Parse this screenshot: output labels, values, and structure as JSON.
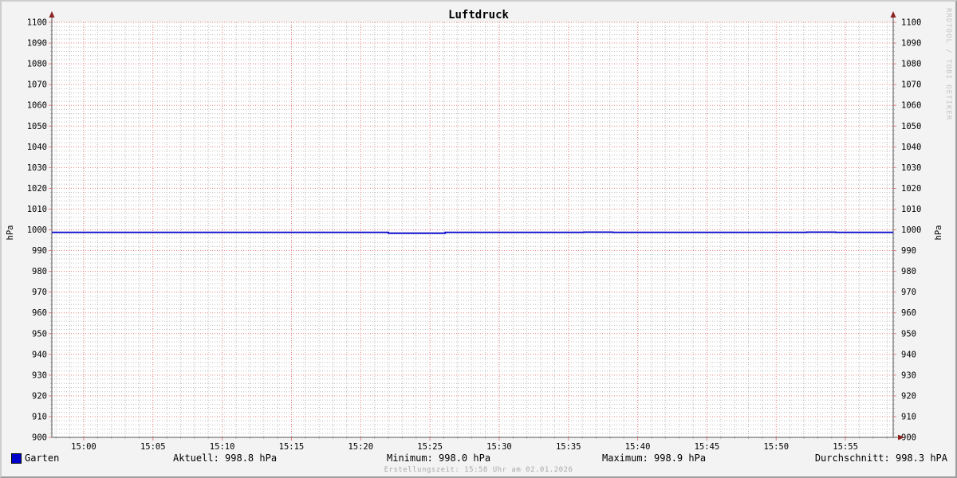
{
  "title": "Luftdruck",
  "watermark": "RRDTOOL / TOBI OETIKER",
  "footer": "Erstellungszeit: 15:58 Uhr am 02.01.2026",
  "axis_titles": {
    "left": "hPa",
    "right": "hPa"
  },
  "legend": {
    "series_label": "Garten",
    "aktuell": "Aktuell: 998.8 hPa",
    "minimum": "Minimum: 998.0 hPa",
    "maximum": "Maximum: 998.9 hPa",
    "durchschnitt": "Durchschnitt: 998.3 hPA"
  },
  "colors": {
    "background": "#f3f3f3",
    "canvas": "#ffffff",
    "line": "#0000cc",
    "grid_major": "#e87d7d",
    "grid_minor": "#bdbdbd",
    "axis": "#555555",
    "arrow": "#8b2323",
    "text": "#000000"
  },
  "chart_data": {
    "type": "line",
    "title": "Luftdruck",
    "ylabel": "hPa",
    "ylabel_right": "hPa",
    "ylim": [
      900,
      1100
    ],
    "y_major_step": 10,
    "y_minor_step": 2,
    "x_total_min": 60.75,
    "x_first_tick_min": 2.3,
    "x_major_step_min": 5,
    "x_minor_step_min": 1,
    "x_tick_labels": [
      "15:00",
      "15:05",
      "15:10",
      "15:15",
      "15:20",
      "15:25",
      "15:30",
      "15:35",
      "15:40",
      "15:45",
      "15:50",
      "15:55"
    ],
    "grid": true,
    "legend_position": "bottom",
    "series": [
      {
        "name": "Garten",
        "color": "#0000cc",
        "unit": "hPa",
        "step": true,
        "points": [
          [
            0,
            998.8
          ],
          [
            24.3,
            998.4
          ],
          [
            28.4,
            998.8
          ],
          [
            38.4,
            998.9
          ],
          [
            40.5,
            998.8
          ],
          [
            54.5,
            998.9
          ],
          [
            56.6,
            998.8
          ],
          [
            60.75,
            998.8
          ]
        ]
      }
    ],
    "stats": {
      "aktuell_hPa": 998.8,
      "minimum_hPa": 998.0,
      "maximum_hPa": 998.9,
      "durchschnitt_hPa": 998.3
    }
  }
}
